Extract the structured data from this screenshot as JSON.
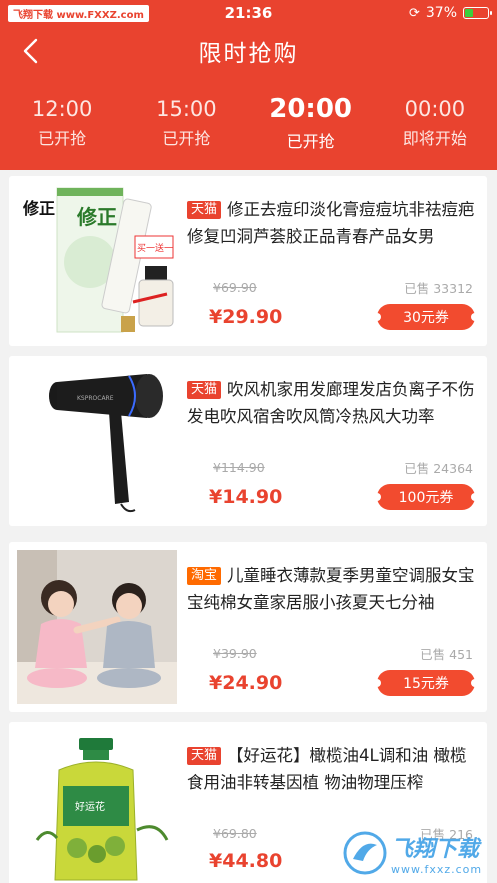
{
  "status": {
    "watermark_badge": "飞翔下载 www.FXXZ.com",
    "time": "21:36",
    "battery": "37%",
    "battery_level": 0.37
  },
  "nav": {
    "title": "限时抢购"
  },
  "tabs": [
    {
      "time": "12:00",
      "state": "已开抢",
      "active": false
    },
    {
      "time": "15:00",
      "state": "已开抢",
      "active": false
    },
    {
      "time": "20:00",
      "state": "已开抢",
      "active": true
    },
    {
      "time": "00:00",
      "state": "即将开始",
      "active": false
    }
  ],
  "products": [
    {
      "tag": "天猫",
      "tag_type": "tmall",
      "title": "修正去痘印淡化膏痘痘坑非祛痘疤修复凹洞芦荟胶正品青春产品女男",
      "original_price": "¥69.90",
      "sold": "已售 33312",
      "price": "¥29.90",
      "coupon": "30元券",
      "image_text": {
        "brand": "修正",
        "promo": "买一送一"
      }
    },
    {
      "tag": "天猫",
      "tag_type": "tmall",
      "title": "吹风机家用发廊理发店负离子不伤发电吹风宿舍吹风筒冷热风大功率",
      "original_price": "¥114.90",
      "sold": "已售 24364",
      "price": "¥14.90",
      "coupon": "100元券",
      "image_text": {
        "brand": "KSPROCARE"
      }
    },
    {
      "tag": "淘宝",
      "tag_type": "taobao",
      "title": "儿童睡衣薄款夏季男童空调服女宝宝纯棉女童家居服小孩夏天七分袖",
      "original_price": "¥39.90",
      "sold": "已售 451",
      "price": "¥24.90",
      "coupon": "15元券",
      "image_text": {}
    },
    {
      "tag": "天猫",
      "tag_type": "tmall",
      "title": "【好运花】橄榄油4L调和油 橄榄食用油非转基因植 物油物理压榨",
      "original_price": "¥69.80",
      "sold": "已售 216",
      "price": "¥44.80",
      "coupon": "",
      "image_text": {
        "label": "好运花"
      }
    }
  ],
  "watermark": {
    "cn": "飞翔下载",
    "url": "www.fxxz.com"
  },
  "colors": {
    "brand_red": "#e9432f",
    "taobao_orange": "#ff6a00",
    "coupon_red": "#f24b2f"
  }
}
